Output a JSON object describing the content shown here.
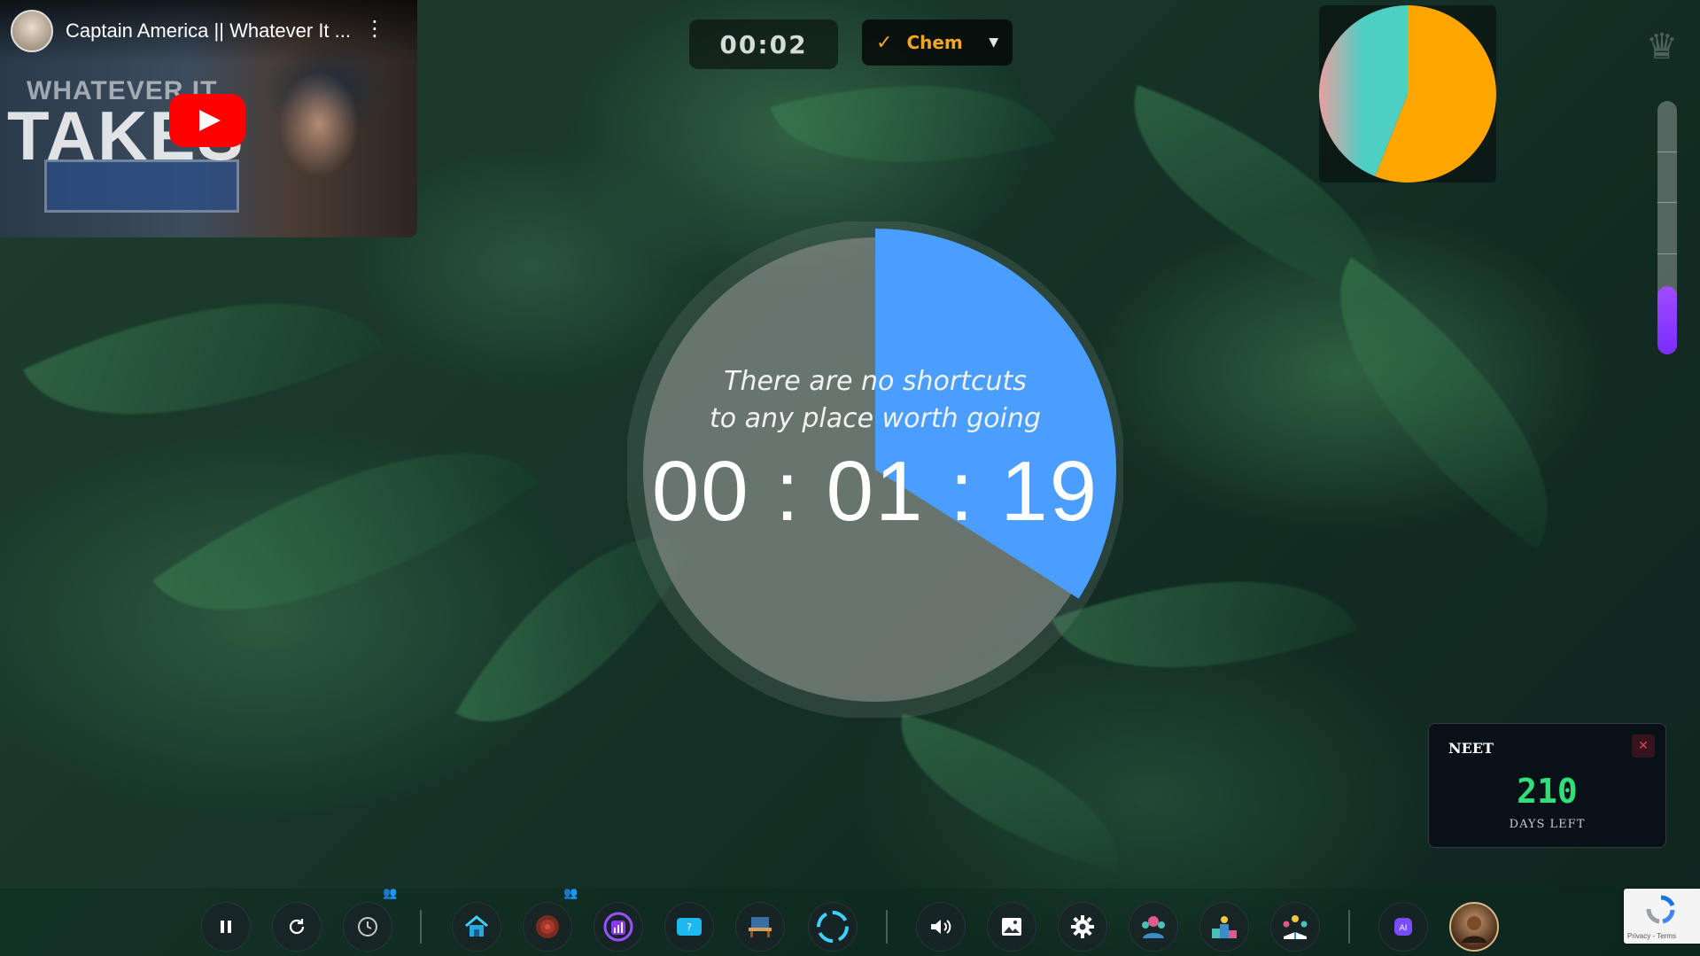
{
  "video": {
    "title": "Captain America || Whatever It ...",
    "thumbnail_line1": "WHATEVER IT",
    "thumbnail_line2": "TAKES"
  },
  "session_timer": "00:02",
  "subject": {
    "selected": "Chem",
    "checked": true
  },
  "pie_widget": {
    "slices": [
      {
        "fraction": 0.56,
        "color": "#ffa500"
      },
      {
        "fraction": 0.44,
        "color": "#4dcfc4"
      }
    ]
  },
  "vertical_progress": {
    "fraction": 0.27,
    "color": "#8a38ff"
  },
  "main_timer": {
    "quote": "There are no shortcuts to any place worth going",
    "time": "00 : 01 : 19",
    "progress_fraction": 0.34,
    "progress_color": "#4a9eff"
  },
  "countdown": {
    "exam": "NEET",
    "days": "210",
    "label": "DAYS LEFT",
    "days_color": "#2fe07a"
  },
  "dock": {
    "items": [
      {
        "name": "pause-button",
        "icon": "pause-icon"
      },
      {
        "name": "reset-button",
        "icon": "refresh-icon"
      },
      {
        "name": "clock-button",
        "icon": "clock-icon"
      },
      {
        "name": "home-button",
        "icon": "home-icon"
      },
      {
        "name": "focus-button",
        "icon": "target-icon"
      },
      {
        "name": "stats-button",
        "icon": "bar-chart-icon"
      },
      {
        "name": "tv-button",
        "icon": "tv-icon"
      },
      {
        "name": "desk-button",
        "icon": "desk-icon"
      },
      {
        "name": "fullscreen-button",
        "icon": "fullscreen-icon"
      },
      {
        "name": "volume-button",
        "icon": "volume-icon"
      },
      {
        "name": "wallpaper-button",
        "icon": "image-icon"
      },
      {
        "name": "settings-button",
        "icon": "gear-icon"
      },
      {
        "name": "community-button",
        "icon": "group-icon"
      },
      {
        "name": "leaderboard-button",
        "icon": "podium-icon"
      },
      {
        "name": "study-group-button",
        "icon": "study-group-icon"
      },
      {
        "name": "ai-button",
        "icon": "ai-bot-icon"
      },
      {
        "name": "profile-button",
        "icon": "avatar"
      }
    ]
  },
  "recaptcha": {
    "footer": "Privacy - Terms"
  }
}
